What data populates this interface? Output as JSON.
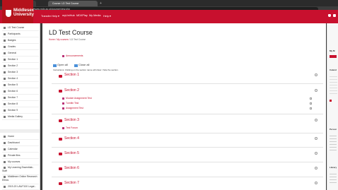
{
  "browser": {
    "tabs": [
      {
        "label": "Middlesex Univers..."
      },
      {
        "label": "Course: LD Test Course"
      }
    ],
    "new_tab": "+",
    "url": "https://www.mdx.ac.uk/course/view.php",
    "back": "‹",
    "forward": "›",
    "reload": "↻",
    "bookmarks": [
      "Apps",
      "Middlesex Univers...",
      "Mdx Staff Intra...",
      "Staff: Intra...",
      "Staff Intranet",
      "Staff resou..."
    ]
  },
  "header": {
    "logo_text": "Middlesex University",
    "nav_items": [
      "Transfer Help ▾",
      "myUniHub",
      "MDXPlay",
      "My Media",
      "Help ▾"
    ]
  },
  "sidebar": {
    "items": [
      {
        "label": "LD Test Course"
      },
      {
        "label": "Participants"
      },
      {
        "label": "Badges"
      },
      {
        "label": "Grades"
      },
      {
        "label": "General"
      },
      {
        "label": "Section 1"
      },
      {
        "label": "Section 2"
      },
      {
        "label": "Section 3"
      },
      {
        "label": "Section 4"
      },
      {
        "label": "Section 5"
      },
      {
        "label": "Section 6"
      },
      {
        "label": "Section 7"
      },
      {
        "label": "Section 8"
      },
      {
        "label": "Section 9"
      },
      {
        "label": "Media Gallery"
      }
    ],
    "items2": [
      {
        "label": "Home"
      },
      {
        "label": "Dashboard"
      },
      {
        "label": "Calendar"
      },
      {
        "label": "Private files"
      },
      {
        "label": "My courses"
      },
      {
        "label": "My Learning Essentials - Staff"
      },
      {
        "label": "Middlesex Online Research Ethics"
      },
      {
        "label": "2019-20 LAW7100 Legal..."
      }
    ]
  },
  "main": {
    "title": "LD Test Course",
    "breadcrumb": {
      "home": "Home",
      "sep1": " / ",
      "courses": "My courses",
      "sep2": " / ",
      "current": "LD Test Course"
    },
    "announcements": "Announcements",
    "open_all": "Open all",
    "close_all": "Close all",
    "instructions": "Instructions: Clicking on the section name will show / hide the section.",
    "sections": [
      {
        "title": "Section 1",
        "activities": []
      },
      {
        "title": "Section 2",
        "activities": [
          "Module Assignment Test",
          "Turnitin Test",
          "Assignment Test"
        ]
      },
      {
        "title": "Section 3",
        "activities": [
          "Test Forum"
        ]
      },
      {
        "title": "Section 4",
        "activities": []
      },
      {
        "title": "Section 5",
        "activities": []
      },
      {
        "title": "Section 6",
        "activities": []
      },
      {
        "title": "Section 7",
        "activities": []
      }
    ]
  },
  "right_panel": {
    "blocks": [
      {
        "title": "My M"
      },
      {
        "title": "Calend"
      },
      {
        "title": "Person"
      },
      {
        "title": "Library"
      }
    ]
  },
  "colors": {
    "brand_red": "#c8102e",
    "logo_red": "#b5121b"
  }
}
